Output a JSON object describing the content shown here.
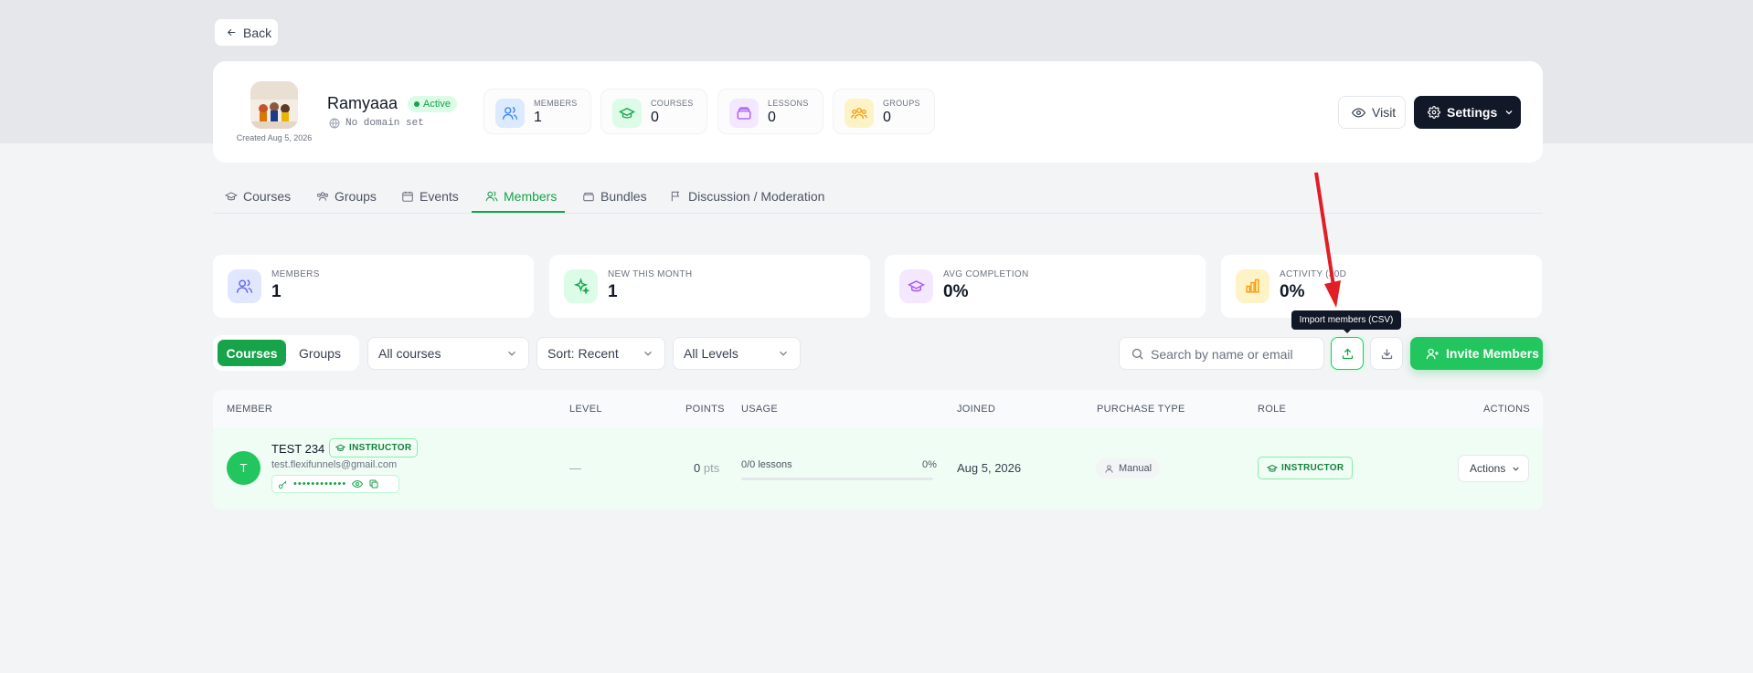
{
  "back": {
    "label": "Back"
  },
  "community": {
    "name": "Ramyaaa",
    "status": "Active",
    "domain": "No domain set",
    "created": "Created Aug 5, 2026"
  },
  "header_stats": [
    {
      "label": "MEMBERS",
      "value": "1",
      "icon": "users-icon",
      "color": "#dbeafe"
    },
    {
      "label": "COURSES",
      "value": "0",
      "icon": "graduation-cap-icon",
      "color": "#dcfce7"
    },
    {
      "label": "LESSONS",
      "value": "0",
      "icon": "archive-icon",
      "color": "#f3e8ff"
    },
    {
      "label": "GROUPS",
      "value": "0",
      "icon": "group-icon",
      "color": "#fef3c7"
    }
  ],
  "header_actions": {
    "visit": "Visit",
    "settings": "Settings"
  },
  "tabs": [
    "Courses",
    "Groups",
    "Events",
    "Members",
    "Bundles",
    "Discussion / Moderation"
  ],
  "active_tab": "Members",
  "stats": [
    {
      "label": "MEMBERS",
      "value": "1",
      "icon": "users-icon",
      "color": "#e0e7ff"
    },
    {
      "label": "NEW THIS MONTH",
      "value": "1",
      "icon": "sparkles-icon",
      "color": "#dcfce7"
    },
    {
      "label": "AVG COMPLETION",
      "value": "0%",
      "icon": "graduation-cap-icon",
      "color": "#f3e8ff"
    },
    {
      "label": "ACTIVITY (30D",
      "value": "0%",
      "icon": "bar-chart-icon",
      "color": "#fef3c7"
    }
  ],
  "filters": {
    "toggle": [
      "Courses",
      "Groups"
    ],
    "course_select": "All courses",
    "sort_select": "Sort: Recent",
    "level_select": "All Levels",
    "search_placeholder": "Search by name or email",
    "tooltip": "Import members (CSV)",
    "invite": "Invite Members"
  },
  "table": {
    "headers": [
      "MEMBER",
      "LEVEL",
      "POINTS",
      "USAGE",
      "JOINED",
      "PURCHASE TYPE",
      "ROLE",
      "ACTIONS"
    ],
    "rows": [
      {
        "initial": "T",
        "name": "TEST 234",
        "badge": "INSTRUCTOR",
        "email": "test.flexifunnels@gmail.com",
        "password": "••••••••••••",
        "level": "—",
        "points": "0",
        "points_unit": "pts",
        "usage_text": "0/0 lessons",
        "usage_pct": "0%",
        "usage_fraction": 0,
        "joined": "Aug 5, 2026",
        "purchase": "Manual",
        "role": "INSTRUCTOR",
        "actions": "Actions"
      }
    ]
  },
  "annotation": {
    "arrow_color": "#e11d26"
  }
}
